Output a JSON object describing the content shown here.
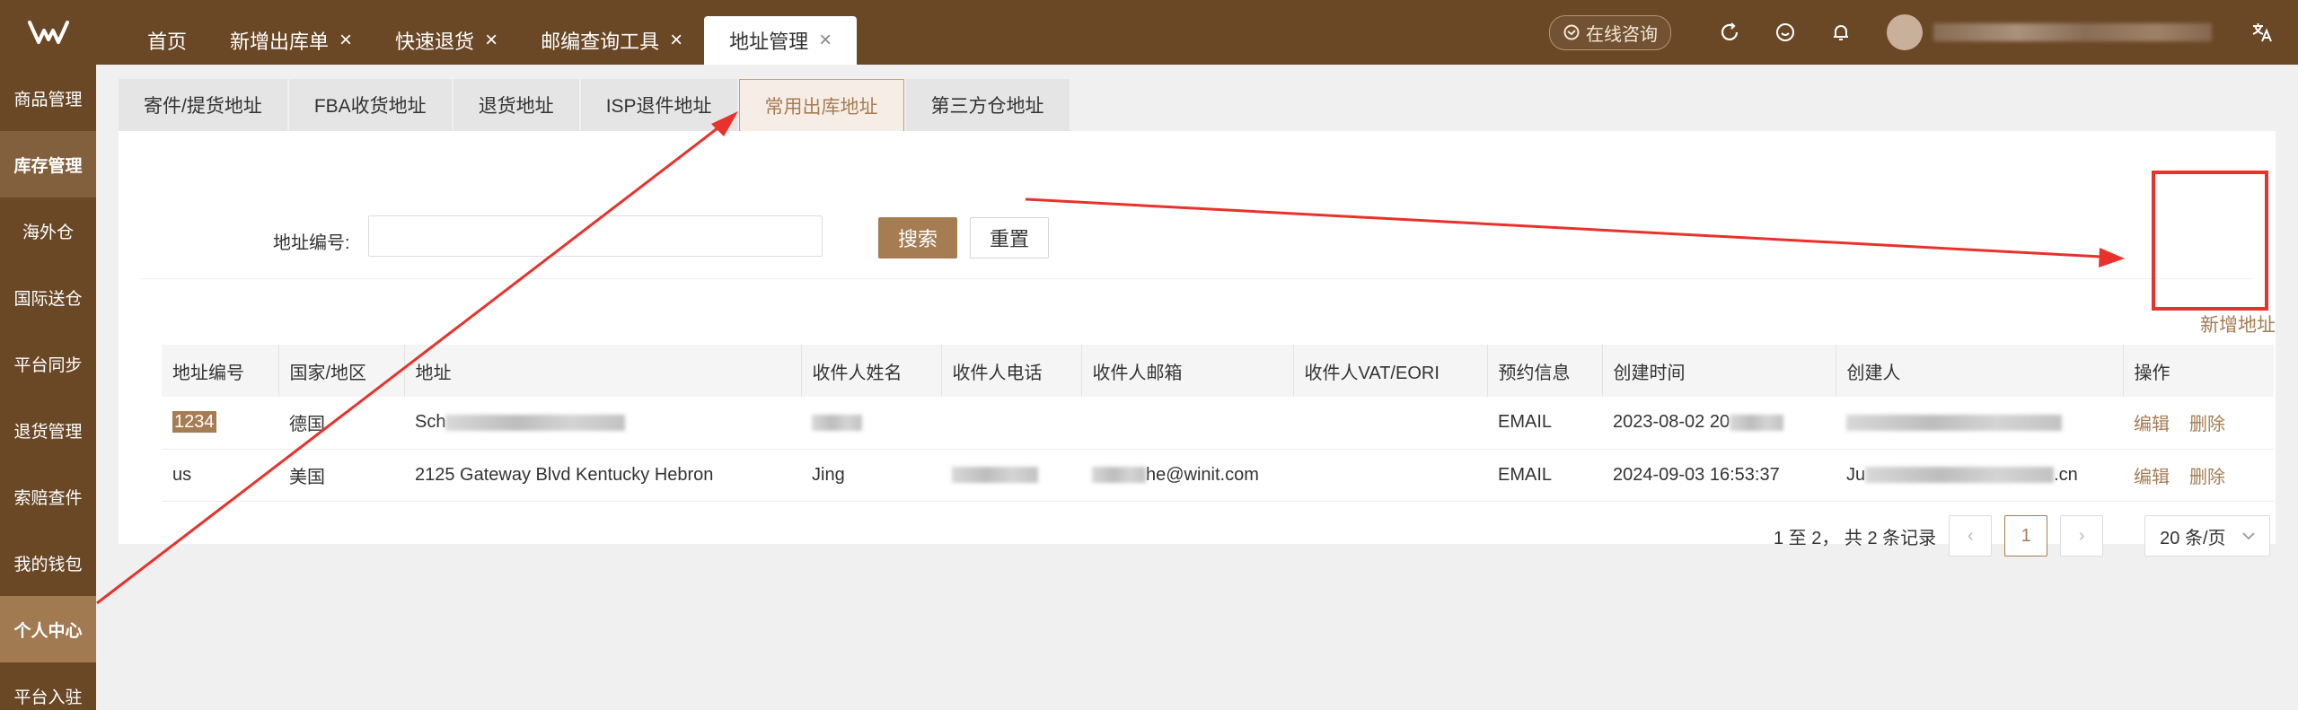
{
  "topbar": {
    "tabs": [
      {
        "label": "首页",
        "closable": false
      },
      {
        "label": "新增出库单",
        "closable": true
      },
      {
        "label": "快速退货",
        "closable": true
      },
      {
        "label": "邮编查询工具",
        "closable": true
      },
      {
        "label": "地址管理",
        "closable": true,
        "active": true
      }
    ],
    "consult_label": "在线咨询"
  },
  "sidebar": {
    "items": [
      {
        "label": "商品管理"
      },
      {
        "label": "库存管理",
        "state": "group-active"
      },
      {
        "label": "海外仓"
      },
      {
        "label": "国际送仓"
      },
      {
        "label": "平台同步"
      },
      {
        "label": "退货管理"
      },
      {
        "label": "索赔查件"
      },
      {
        "label": "我的钱包"
      },
      {
        "label": "个人中心",
        "state": "selected"
      },
      {
        "label": "平台入驻"
      }
    ]
  },
  "subtabs": [
    {
      "label": "寄件/提货地址"
    },
    {
      "label": "FBA收货地址"
    },
    {
      "label": "退货地址"
    },
    {
      "label": "ISP退件地址"
    },
    {
      "label": "常用出库地址",
      "active": true
    },
    {
      "label": "第三方仓地址"
    }
  ],
  "search": {
    "label": "地址编号:",
    "value": "",
    "search_button": "搜索",
    "reset_button": "重置"
  },
  "add_address_link": "新增地址",
  "table": {
    "columns": [
      "地址编号",
      "国家/地区",
      "地址",
      "收件人姓名",
      "收件人电话",
      "收件人邮箱",
      "收件人VAT/EORI",
      "预约信息",
      "创建时间",
      "创建人",
      "操作"
    ],
    "rows": [
      {
        "code": "1234",
        "country": "德国",
        "address": "Sch",
        "name": "",
        "phone": "",
        "email": "",
        "vat": "",
        "booking": "EMAIL",
        "created": "2023-08-02 20",
        "creator": "",
        "edit": "编辑",
        "delete": "删除"
      },
      {
        "code": "us",
        "country": "美国",
        "address": "2125 Gateway Blvd Kentucky Hebron",
        "name": "Jing",
        "phone": "",
        "email": "he@winit.com",
        "vat": "",
        "booking": "EMAIL",
        "created": "2024-09-03 16:53:37",
        "creator": "Ju",
        "creator_suffix": ".cn",
        "edit": "编辑",
        "delete": "删除"
      }
    ]
  },
  "pagination": {
    "summary": "1 至 2，  共 2 条记录",
    "current_page": "1",
    "page_size": "20 条/页"
  },
  "colors": {
    "brand_dark": "#6a4826",
    "accent": "#a67c52",
    "annotation_red": "#e8322b"
  }
}
